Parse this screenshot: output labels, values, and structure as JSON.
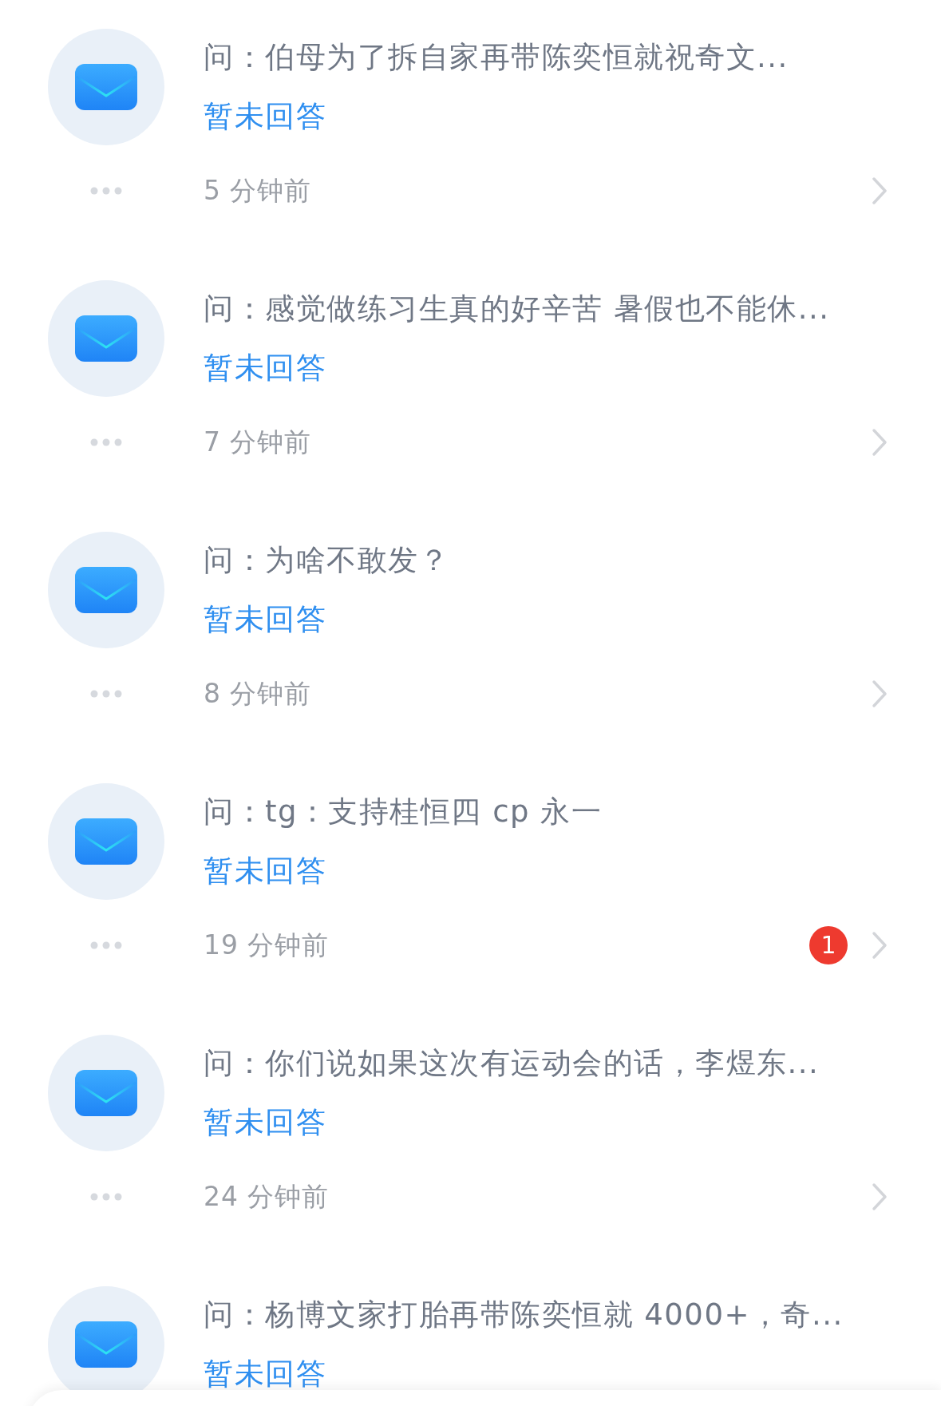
{
  "messages": [
    {
      "question": "问：伯母为了拆自家再带陈奕恒就祝奇文...",
      "status": "暂未回答",
      "time": "5 分钟前"
    },
    {
      "question": "问：感觉做练习生真的好辛苦 暑假也不能休...",
      "status": "暂未回答",
      "time": "7 分钟前"
    },
    {
      "question": "问：为啥不敢发？",
      "status": "暂未回答",
      "time": "8 分钟前"
    },
    {
      "question": "问：tg：支持桂恒四 cp 永一",
      "status": "暂未回答",
      "time": "19 分钟前",
      "badge": "1"
    },
    {
      "question": "问：你们说如果这次有运动会的话，李煜东...",
      "status": "暂未回答",
      "time": "24 分钟前"
    },
    {
      "question": "问：杨博文家打胎再带陈奕恒就 4000+，奇...",
      "status": "暂未回答"
    }
  ]
}
